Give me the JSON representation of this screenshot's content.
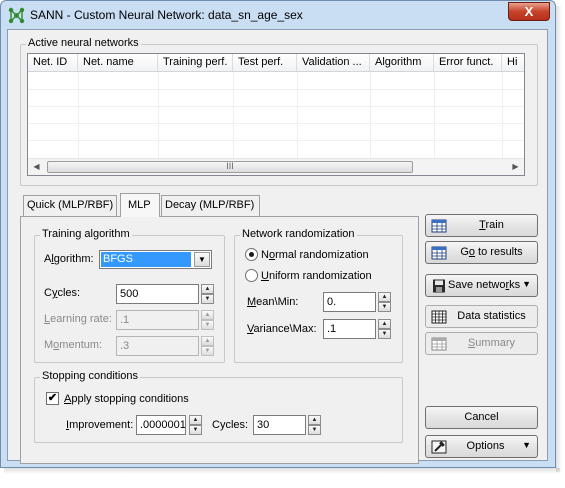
{
  "window": {
    "title": "SANN - Custom Neural Network: data_sn_age_sex",
    "close_glyph": "X"
  },
  "networks_group": {
    "label": "Active neural networks",
    "columns": [
      "Net. ID",
      "Net. name",
      "Training perf.",
      "Test perf.",
      "Validation ...",
      "Algorithm",
      "Error funct.",
      "Hi"
    ],
    "scroll_thumb_grip": "III"
  },
  "tabs": [
    {
      "label": "Quick (MLP/RBF)",
      "active": false
    },
    {
      "label": "MLP",
      "active": true
    },
    {
      "label": "Decay (MLP/RBF)",
      "active": false
    }
  ],
  "training_algorithm": {
    "label": "Training algorithm",
    "algorithm_label_pre": "A",
    "algorithm_label_u": "l",
    "algorithm_label_post": "gorithm:",
    "algorithm_value": "BFGS",
    "cycles_label_pre": "C",
    "cycles_label_u": "y",
    "cycles_label_post": "cles:",
    "cycles_value": "500",
    "learning_rate_label_pre": "",
    "learning_rate_label_u": "L",
    "learning_rate_label_post": "earning rate:",
    "learning_rate_value": ".1",
    "momentum_label_pre": "M",
    "momentum_label_u": "o",
    "momentum_label_post": "mentum:",
    "momentum_value": ".3"
  },
  "network_randomization": {
    "label": "Network randomization",
    "normal_pre": "N",
    "normal_u": "o",
    "normal_post": "rmal randomization",
    "normal_selected": true,
    "uniform_pre": "",
    "uniform_u": "U",
    "uniform_post": "niform randomization",
    "mean_label_pre": "",
    "mean_label_u": "M",
    "mean_label_post": "ean\\Min:",
    "mean_value": "0.",
    "variance_label_pre": "",
    "variance_label_u": "V",
    "variance_label_post": "ariance\\Max:",
    "variance_value": ".1"
  },
  "stopping": {
    "label": "Stopping conditions",
    "apply_pre": "",
    "apply_u": "A",
    "apply_post": "pply stopping conditions",
    "apply_checked": true,
    "check_glyph": "✔",
    "improvement_label_pre": "",
    "improvement_label_u": "I",
    "improvement_label_post": "mprovement:",
    "improvement_value": ".0000001",
    "cycles_label": "Cycles:",
    "cycles_value": "30"
  },
  "buttons": {
    "train_pre": "",
    "train_u": "T",
    "train_post": "rain",
    "go_results_pre": "G",
    "go_results_u": "o",
    "go_results_post": " to results",
    "save_networks_pre": "Save netwo",
    "save_networks_u": "r",
    "save_networks_post": "ks",
    "data_statistics": "Data statistics",
    "summary_pre": "",
    "summary_u": "S",
    "summary_post": "ummary",
    "cancel": "Cancel",
    "options": "Options"
  },
  "icons": {
    "app": "neural-network-icon",
    "train": "train-grid-icon",
    "go_results": "results-grid-icon",
    "save": "floppy-disk-icon",
    "stats": "spreadsheet-icon",
    "summary": "summary-sheet-icon",
    "options": "options-hammer-icon"
  },
  "colors": {
    "selection": "#3399ff",
    "titlebar": "#c9ddf3",
    "close": "#c7432a",
    "app_icon": "#2e8b2e"
  }
}
